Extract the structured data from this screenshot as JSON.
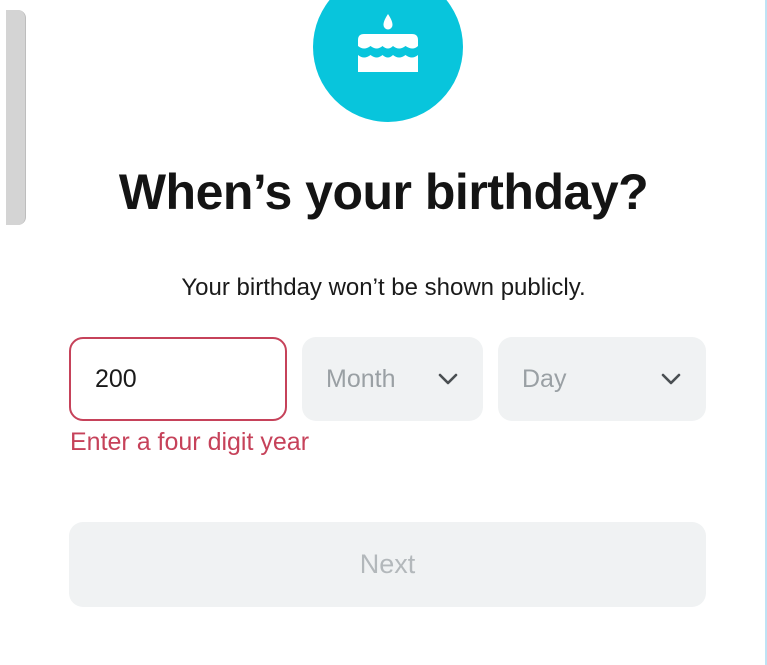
{
  "heading": {
    "title": "When’s your birthday?",
    "subtitle": "Your birthday won’t be shown publicly."
  },
  "hero": {
    "icon": "birthday-cake-icon",
    "circle_color": "#08c5dc"
  },
  "form": {
    "year": {
      "value": "200"
    },
    "month": {
      "selected": "Month"
    },
    "day": {
      "selected": "Day"
    },
    "error": "Enter a four digit year"
  },
  "actions": {
    "next_label": "Next"
  },
  "colors": {
    "accent": "#08c5dc",
    "error": "#c6425a",
    "field_bg": "#f0f2f3",
    "disabled_text": "#b3b8bb"
  }
}
